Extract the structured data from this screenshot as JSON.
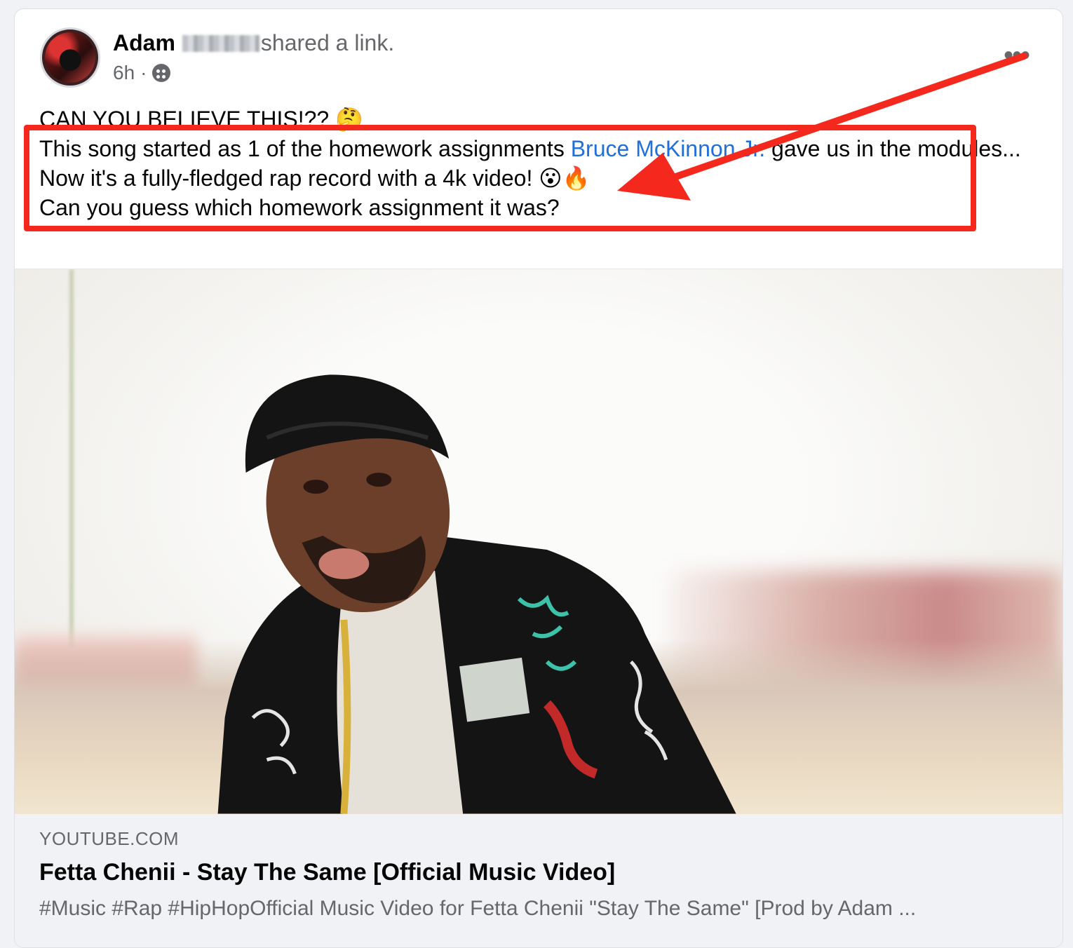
{
  "post": {
    "author": "Adam",
    "shared_text": "shared a link.",
    "time": "6h",
    "separator": "·",
    "more_label": "•••",
    "lines": {
      "line1": "CAN YOU BELIEVE THIS!?? 🤔",
      "line2_before": "This song started as 1 of the homework assignments ",
      "mention": "Bruce McKinnon Jr.",
      "line2_after": " gave us in the modules...",
      "line3": "Now it's a fully-fledged rap record with a 4k video! 😮🔥",
      "line4": "Can you guess which homework assignment it was?"
    }
  },
  "link": {
    "domain": "YOUTUBE.COM",
    "title": "Fetta Chenii - Stay The Same [Official Music Video]",
    "description": "#Music #Rap #HipHopOfficial Music Video for Fetta Chenii \"Stay The Same\" [Prod by Adam ..."
  },
  "annotation": {
    "highlight_color": "#f4281c"
  },
  "colors": {
    "mention": "#216fdb",
    "secondary_text": "#65676b"
  }
}
